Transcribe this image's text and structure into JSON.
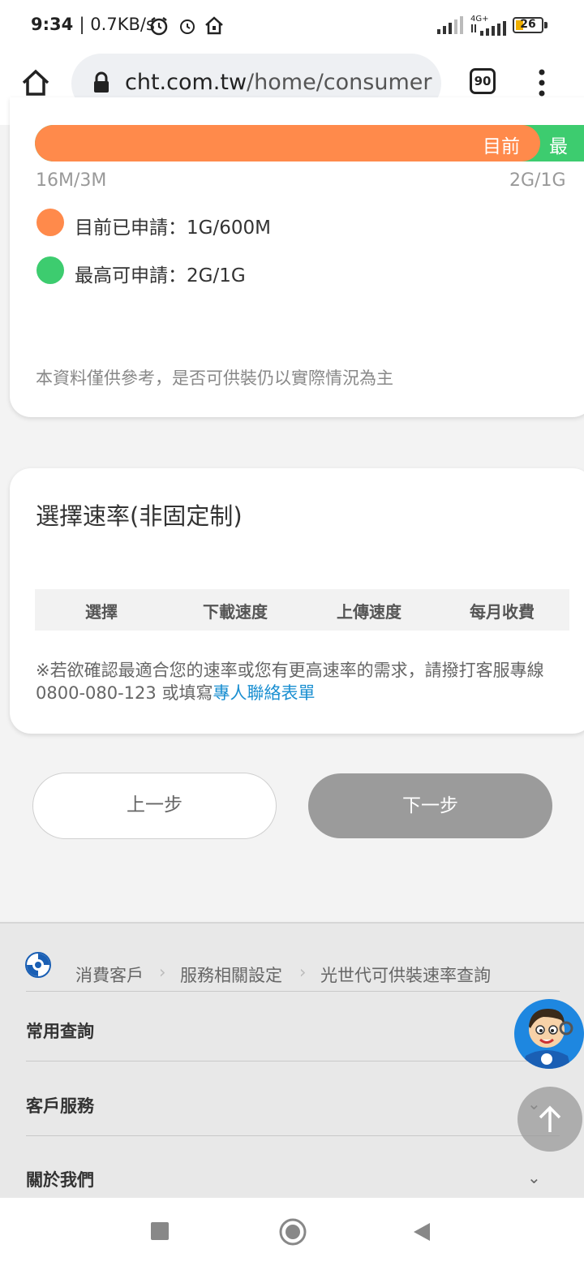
{
  "status_bar": {
    "time": "9:34",
    "speed": "| 0.7KB/s",
    "network": "4G+",
    "battery": "26"
  },
  "browser": {
    "url_host": "cht.com.tw",
    "url_path": "/home/consumer",
    "tab_count": "90"
  },
  "speed_card": {
    "bar_current_label": "目前",
    "bar_max_label": "最高",
    "scale_min": "16M/3M",
    "scale_max": "2G/1G",
    "current_applied": "目前已申請：1G/600M",
    "max_available": "最高可申請：2G/1G",
    "note": "本資料僅供參考，是否可供裝仍以實際情況為主",
    "current_fraction": 0.92
  },
  "rate_card": {
    "title": "選擇速率(非固定制)",
    "headers": [
      "選擇",
      "下載速度",
      "上傳速度",
      "每月收費"
    ],
    "footnote": "※若欲確認最適合您的速率或您有更高速率的需求，請撥打客服專線0800-080-123 或填寫",
    "footnote_link": "專人聯絡表單"
  },
  "buttons": {
    "prev": "上一步",
    "next": "下一步"
  },
  "footer": {
    "breadcrumb": [
      "消費客戶",
      "服務相關設定",
      "光世代可供裝速率查詢"
    ],
    "sections": [
      "常用查詢",
      "客戶服務",
      "關於我們"
    ]
  },
  "colors": {
    "current": "#ff8a4b",
    "max": "#3dcc6f",
    "link": "#1a8fd1",
    "next_button": "#9b9b9b"
  }
}
